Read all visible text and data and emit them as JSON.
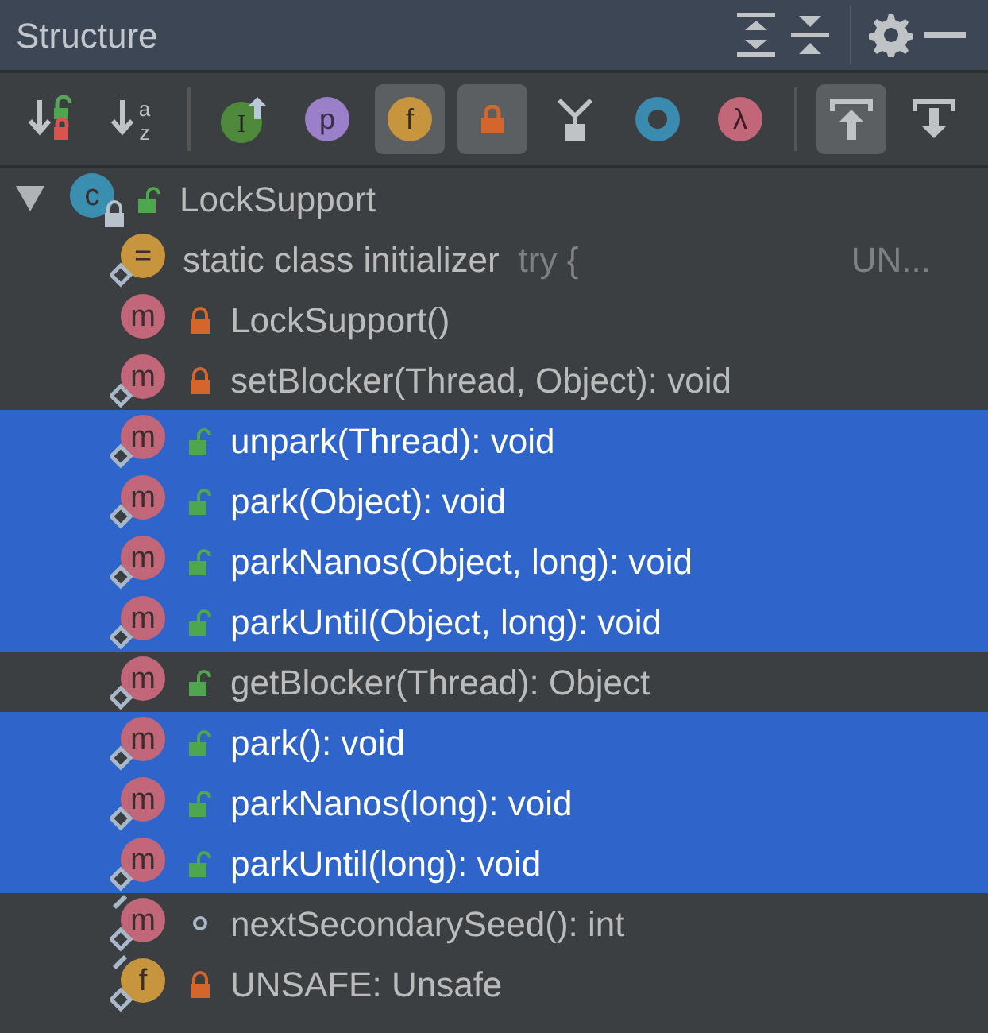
{
  "title": "Structure",
  "header_actions": [
    {
      "kind": "expand"
    },
    {
      "kind": "collapse"
    },
    {
      "kind": "separator"
    },
    {
      "kind": "settings"
    },
    {
      "kind": "hide"
    }
  ],
  "toolbar": [
    {
      "kind": "sort-visibility",
      "toggled": false
    },
    {
      "kind": "sort-alpha",
      "toggled": false,
      "glyph_top": "a",
      "glyph_bottom": "z"
    },
    {
      "kind": "separator"
    },
    {
      "kind": "inherited",
      "toggled": false,
      "glyph": "I"
    },
    {
      "kind": "properties",
      "toggled": false,
      "glyph": "p"
    },
    {
      "kind": "fields",
      "toggled": true,
      "glyph": "f"
    },
    {
      "kind": "non-public",
      "toggled": true
    },
    {
      "kind": "anonymous",
      "toggled": false
    },
    {
      "kind": "ring",
      "toggled": false
    },
    {
      "kind": "lambdas",
      "toggled": false,
      "glyph": "λ"
    },
    {
      "kind": "separator"
    },
    {
      "kind": "scroll-to-source",
      "toggled": true
    },
    {
      "kind": "scroll-from-source",
      "toggled": false
    }
  ],
  "tree": [
    {
      "kind": "class",
      "badge": "c",
      "modifier": {
        "kind": "public"
      },
      "static": false,
      "final": false,
      "text": "LockSupport",
      "selected": false,
      "expanded": true,
      "children": [
        {
          "kind": "initializer",
          "badge": "=",
          "static": true,
          "final": false,
          "text": "static class initializer",
          "hint": "try {",
          "trailing": "UN...",
          "selected": false
        },
        {
          "kind": "method",
          "badge": "m",
          "modifier": {
            "kind": "private"
          },
          "static": false,
          "final": false,
          "text": "LockSupport()",
          "selected": false
        },
        {
          "kind": "method",
          "badge": "m",
          "modifier": {
            "kind": "private"
          },
          "static": true,
          "final": false,
          "text": "setBlocker(Thread, Object): void",
          "selected": false
        },
        {
          "kind": "method",
          "badge": "m",
          "modifier": {
            "kind": "public"
          },
          "static": true,
          "final": false,
          "text": "unpark(Thread): void",
          "selected": true
        },
        {
          "kind": "method",
          "badge": "m",
          "modifier": {
            "kind": "public"
          },
          "static": true,
          "final": false,
          "text": "park(Object): void",
          "selected": true
        },
        {
          "kind": "method",
          "badge": "m",
          "modifier": {
            "kind": "public"
          },
          "static": true,
          "final": false,
          "text": "parkNanos(Object, long): void",
          "selected": true
        },
        {
          "kind": "method",
          "badge": "m",
          "modifier": {
            "kind": "public"
          },
          "static": true,
          "final": false,
          "text": "parkUntil(Object, long): void",
          "selected": true
        },
        {
          "kind": "method",
          "badge": "m",
          "modifier": {
            "kind": "public"
          },
          "static": true,
          "final": false,
          "text": "getBlocker(Thread): Object",
          "selected": false
        },
        {
          "kind": "method",
          "badge": "m",
          "modifier": {
            "kind": "public"
          },
          "static": true,
          "final": false,
          "text": "park(): void",
          "selected": true
        },
        {
          "kind": "method",
          "badge": "m",
          "modifier": {
            "kind": "public"
          },
          "static": true,
          "final": false,
          "text": "parkNanos(long): void",
          "selected": true
        },
        {
          "kind": "method",
          "badge": "m",
          "modifier": {
            "kind": "public"
          },
          "static": true,
          "final": false,
          "text": "parkUntil(long): void",
          "selected": true
        },
        {
          "kind": "method",
          "badge": "m",
          "modifier": {
            "kind": "package"
          },
          "static": true,
          "final": true,
          "text": "nextSecondarySeed(): int",
          "selected": false
        },
        {
          "kind": "field",
          "badge": "f",
          "modifier": {
            "kind": "private"
          },
          "static": true,
          "final": true,
          "text": "UNSAFE: Unsafe",
          "selected": false
        }
      ]
    }
  ]
}
